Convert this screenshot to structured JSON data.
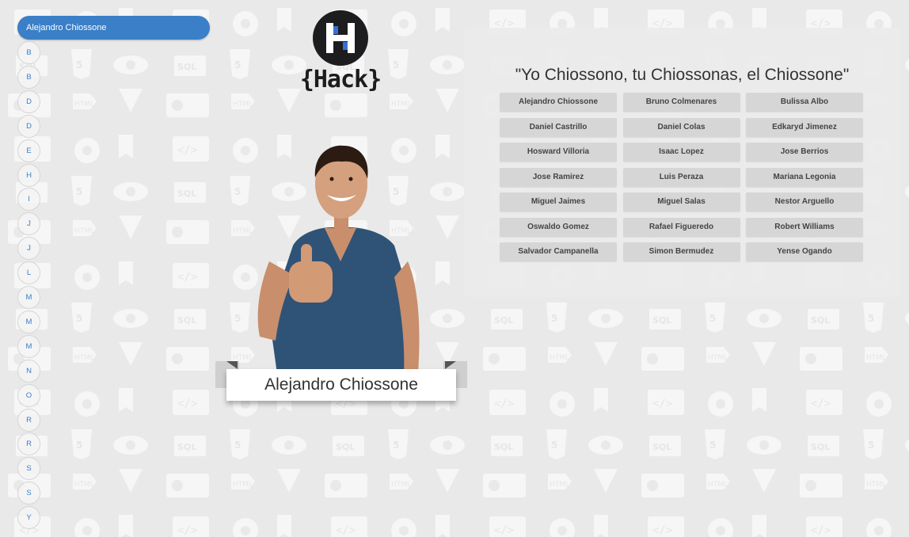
{
  "sidebar": {
    "active_name": "Alejandro Chiossone",
    "active_color": "#3a7fc7",
    "letters": [
      "B",
      "B",
      "D",
      "D",
      "E",
      "H",
      "I",
      "J",
      "J",
      "L",
      "M",
      "M",
      "M",
      "N",
      "O",
      "R",
      "R",
      "S",
      "S",
      "Y"
    ]
  },
  "logo": {
    "text": "{Hack}",
    "icon": "hack-logo-icon"
  },
  "profile": {
    "name": "Alejandro Chiossone"
  },
  "panel": {
    "quote": "\"Yo Chiossono, tu Chiossonas, el Chiossone\"",
    "names": [
      "Alejandro Chiossone",
      "Bruno Colmenares",
      "Bulissa Albo",
      "Daniel Castrillo",
      "Daniel Colas",
      "Edkaryd Jimenez",
      "Hosward Villoria",
      "Isaac Lopez",
      "Jose Berrios",
      "Jose Ramirez",
      "Luis Peraza",
      "Mariana Legonia",
      "Miguel Jaimes",
      "Miguel Salas",
      "Nestor Arguello",
      "Oswaldo Gomez",
      "Rafael Figueredo",
      "Robert Williams",
      "Salvador Campanella",
      "Simon Bermudez",
      "Yense Ogando"
    ]
  }
}
